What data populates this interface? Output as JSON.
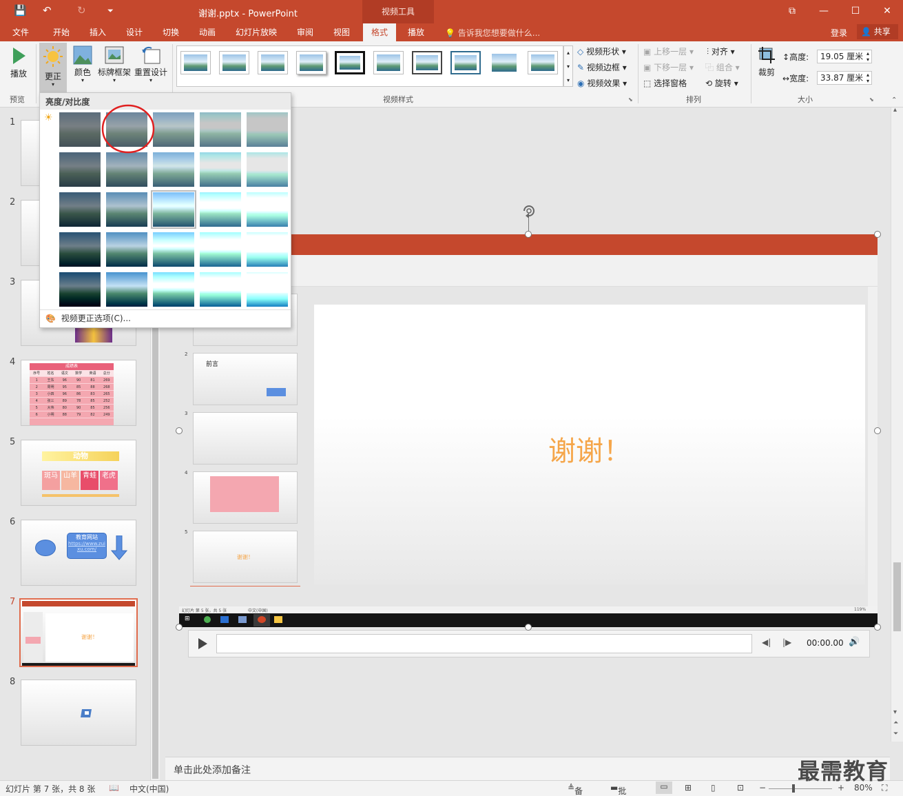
{
  "titlebar": {
    "doc_title": "谢谢.pptx - PowerPoint",
    "context_tab": "视频工具",
    "save_glyph": "💾",
    "undo_glyph": "↶",
    "redo_glyph": "↻",
    "qa_more_glyph": "⏷",
    "restore_glyph": "⧉",
    "minimize_glyph": "—",
    "maximize_glyph": "☐",
    "close_glyph": "✕"
  },
  "tabs": [
    "文件",
    "开始",
    "插入",
    "设计",
    "切换",
    "动画",
    "幻灯片放映",
    "审阅",
    "视图",
    "格式",
    "播放"
  ],
  "active_tab": "格式",
  "tellme": "告诉我您想要做什么...",
  "login": "登录",
  "share": "共享",
  "ribbon": {
    "play_label": "播放",
    "preview_group": "预览",
    "correct_label": "更正",
    "color_label": "颜色",
    "poster_label": "标牌框架",
    "reset_label": "重置设计",
    "video_styles_group": "视频样式",
    "video_shape": "视频形状",
    "video_border": "视频边框",
    "video_effects": "视频效果",
    "bring_forward": "上移一层",
    "send_backward": "下移一层",
    "selection_pane": "选择窗格",
    "align": "对齐",
    "group": "组合",
    "rotate": "旋转",
    "arrange_group": "排列",
    "crop_label": "裁剪",
    "height_label": "高度:",
    "height_value": "19.05 厘米",
    "width_label": "宽度:",
    "width_value": "33.87 厘米",
    "size_group": "大小"
  },
  "gallery": {
    "header": "亮度/对比度",
    "options_link": "视频更正选项(C)..."
  },
  "slides": [
    {
      "num": "1"
    },
    {
      "num": "2"
    },
    {
      "num": "3"
    },
    {
      "num": "4",
      "table_title": "成绩表",
      "headers": [
        "序号",
        "姓名",
        "语文",
        "数学",
        "英语",
        "总分"
      ],
      "rows": [
        [
          "1",
          "王东",
          "96",
          "90",
          "81",
          "269"
        ],
        [
          "2",
          "周明",
          "95",
          "85",
          "88",
          "268"
        ],
        [
          "3",
          "小四",
          "96",
          "86",
          "83",
          "265"
        ],
        [
          "4",
          "张三",
          "89",
          "78",
          "85",
          "252"
        ],
        [
          "5",
          "大伟",
          "80",
          "90",
          "85",
          "256"
        ],
        [
          "6",
          "小明",
          "88",
          "79",
          "82",
          "249"
        ]
      ]
    },
    {
      "num": "5",
      "banner": "动物",
      "cells": [
        "斑马",
        "山羊",
        "青蛙",
        "老虎"
      ]
    },
    {
      "num": "6",
      "box_title": "教育网站",
      "box_link": "https://www.zuixu.com/"
    },
    {
      "num": "7",
      "thumb_text": "谢谢！"
    },
    {
      "num": "8"
    }
  ],
  "current_slide": "7",
  "video": {
    "inner_slide_text": "谢谢！",
    "mini_slide_num_2": "2",
    "mini_slide_num_3": "3",
    "mini_slide_num_4": "4",
    "mini_slide_num_5": "5",
    "mini_title_2": "前言",
    "mini_text_5": "谢谢！",
    "inner_status": "幻灯片 第 5 张，共 5 张",
    "inner_lang": "中文(中国)",
    "inner_zoom": "119%"
  },
  "playback": {
    "time": "00:00.00"
  },
  "notes_placeholder": "单击此处添加备注",
  "status": {
    "slide_info": "幻灯片 第 7 张，共 8 张",
    "language": "中文(中国)",
    "notes": "备注",
    "comments": "批注",
    "zoom": "80%"
  },
  "watermark": "最需教育",
  "colors": {
    "accent": "#c5482d",
    "ribbon_bg": "#f3f3f3",
    "highlight_circle": "#e02020"
  }
}
